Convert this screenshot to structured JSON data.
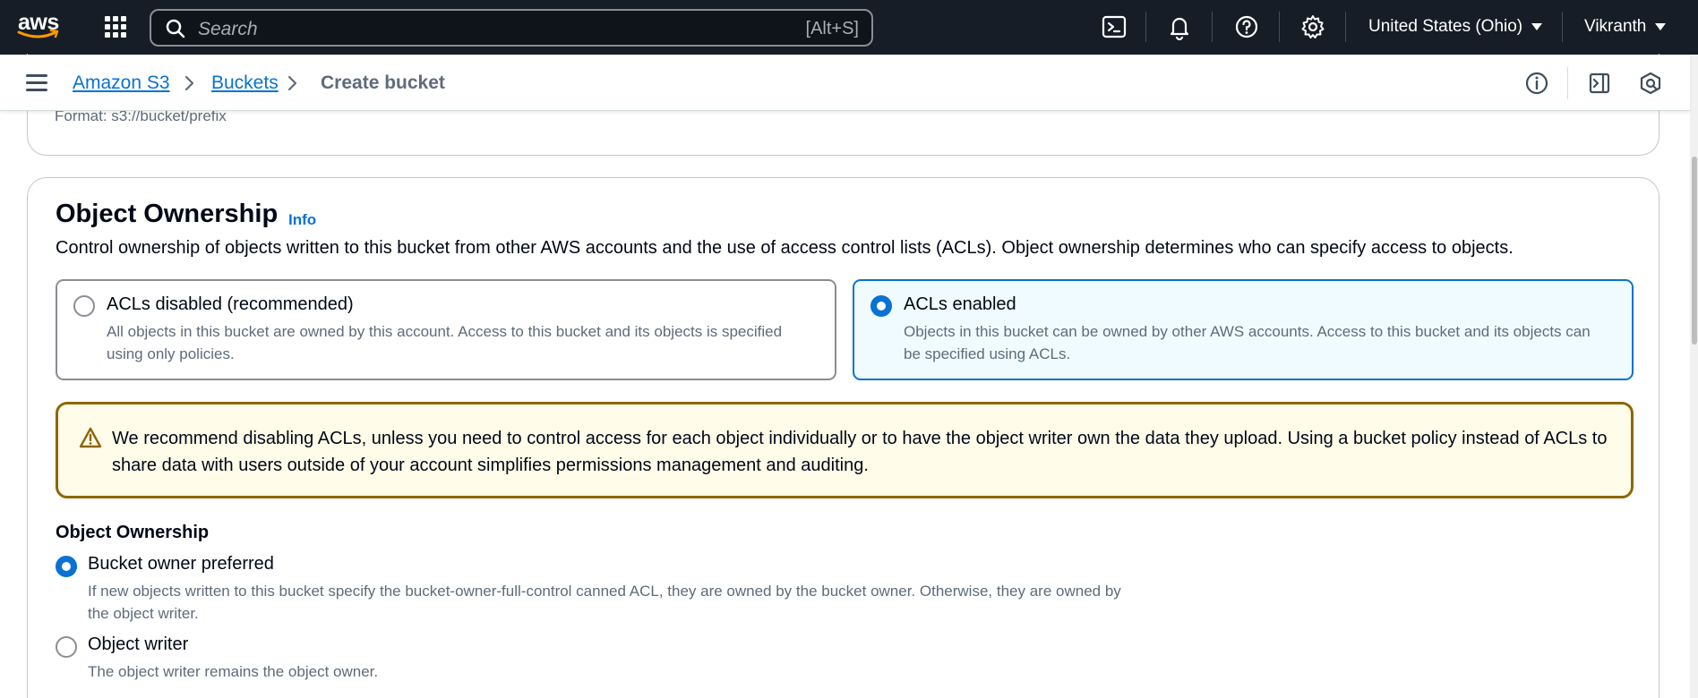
{
  "topnav": {
    "logo_text": "aws",
    "search_placeholder": "Search",
    "search_shortcut": "[Alt+S]",
    "region": "United States (Ohio)",
    "user": "Vikranth",
    "icons": [
      "cloudshell-icon",
      "bell-icon",
      "help-icon",
      "gear-icon"
    ]
  },
  "breadcrumb": {
    "items": [
      {
        "label": "Amazon S3"
      },
      {
        "label": "Buckets"
      }
    ],
    "current": "Create bucket",
    "tools": [
      "info-circle-icon",
      "side-panel-icon",
      "security-hub-icon"
    ]
  },
  "previous_section": {
    "format_hint": "Format: s3://bucket/prefix"
  },
  "object_ownership": {
    "title": "Object Ownership",
    "info_label": "Info",
    "description": "Control ownership of objects written to this bucket from other AWS accounts and the use of access control lists (ACLs). Object ownership determines who can specify access to objects.",
    "tiles": [
      {
        "label": "ACLs disabled (recommended)",
        "description": "All objects in this bucket are owned by this account. Access to this bucket and its objects is specified using only policies.",
        "selected": false
      },
      {
        "label": "ACLs enabled",
        "description": "Objects in this bucket can be owned by other AWS accounts. Access to this bucket and its objects can be specified using ACLs.",
        "selected": true
      }
    ],
    "alert": {
      "icon": "warning-icon",
      "text": "We recommend disabling ACLs, unless you need to control access for each object individually or to have the object writer own the data they upload. Using a bucket policy instead of ACLs to share data with users outside of your account simplifies permissions management and auditing."
    },
    "ownership_label": "Object Ownership",
    "options": [
      {
        "label": "Bucket owner preferred",
        "description": "If new objects written to this bucket specify the bucket-owner-full-control canned ACL, they are owned by the bucket owner. Otherwise, they are owned by the object writer.",
        "selected": true
      },
      {
        "label": "Object writer",
        "description": "The object writer remains the object owner.",
        "selected": false
      }
    ]
  },
  "colors": {
    "nav_bg": "#161d26",
    "link": "#0972d3",
    "warning_border": "#8d6605",
    "warning_bg": "#fffce9",
    "selected_bg": "#f0fbff"
  }
}
